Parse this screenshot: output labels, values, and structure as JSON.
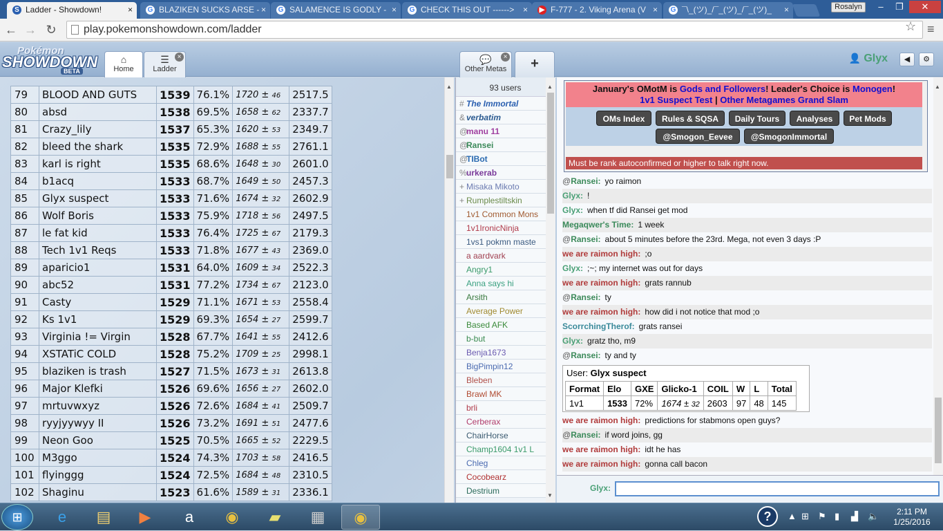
{
  "browser": {
    "tabs": [
      {
        "title": "Ladder - Showdown!",
        "icon": "S",
        "active": true
      },
      {
        "title": "BLAZIKEN SUCKS ARSE - ",
        "icon": "G"
      },
      {
        "title": "SALAMENCE IS GODLY - ",
        "icon": "G"
      },
      {
        "title": "CHECK THIS OUT ------>",
        "icon": "G"
      },
      {
        "title": "F-777 - 2. Viking Arena (V",
        "icon": "▶"
      },
      {
        "title": "¯\\_(ツ)_/¯_(ツ)_/¯_(ツ)_",
        "icon": "G"
      }
    ],
    "profile": "Rosalyn",
    "url": "play.pokemonshowdown.com/ladder"
  },
  "header": {
    "logo_top": "Pokémon",
    "logo_main": "SHOWDOWN",
    "logo_beta": "BETA",
    "tab_home": "Home",
    "tab_ladder": "Ladder",
    "tab_othermetas": "Other Metas",
    "tab_add": "+",
    "username": "Glyx"
  },
  "ladder": {
    "rows": [
      [
        "79",
        "BLOOD AND GUTS",
        "1539",
        "76.1%",
        "1720",
        "46",
        "2517.5"
      ],
      [
        "80",
        "absd",
        "1538",
        "69.5%",
        "1658",
        "62",
        "2337.7"
      ],
      [
        "81",
        "Crazy_lily",
        "1537",
        "65.3%",
        "1620",
        "53",
        "2349.7"
      ],
      [
        "82",
        "bleed the shark",
        "1535",
        "72.9%",
        "1688",
        "55",
        "2761.1"
      ],
      [
        "83",
        "karl is right",
        "1535",
        "68.6%",
        "1648",
        "30",
        "2601.0"
      ],
      [
        "84",
        "b1acq",
        "1533",
        "68.7%",
        "1649",
        "50",
        "2457.3"
      ],
      [
        "85",
        "Glyx suspect",
        "1533",
        "71.6%",
        "1674",
        "32",
        "2602.9"
      ],
      [
        "86",
        "Wolf Boris",
        "1533",
        "75.9%",
        "1718",
        "56",
        "2497.5"
      ],
      [
        "87",
        "le fat kid",
        "1533",
        "76.4%",
        "1725",
        "67",
        "2179.3"
      ],
      [
        "88",
        "Tech 1v1 Reqs",
        "1533",
        "71.8%",
        "1677",
        "43",
        "2369.0"
      ],
      [
        "89",
        "aparicio1",
        "1531",
        "64.0%",
        "1609",
        "34",
        "2522.3"
      ],
      [
        "90",
        "abc52",
        "1531",
        "77.2%",
        "1734",
        "67",
        "2123.0"
      ],
      [
        "91",
        "Casty",
        "1529",
        "71.1%",
        "1671",
        "53",
        "2558.4"
      ],
      [
        "92",
        "Ks 1v1",
        "1529",
        "69.3%",
        "1654",
        "27",
        "2599.7"
      ],
      [
        "93",
        "Virginia != Virgin",
        "1528",
        "67.7%",
        "1641",
        "55",
        "2412.6"
      ],
      [
        "94",
        "XSTATiC COLD",
        "1528",
        "75.2%",
        "1709",
        "25",
        "2998.1"
      ],
      [
        "95",
        "blaziken is trash",
        "1527",
        "71.5%",
        "1673",
        "31",
        "2613.8"
      ],
      [
        "96",
        "Major Klefki",
        "1526",
        "69.6%",
        "1656",
        "27",
        "2602.0"
      ],
      [
        "97",
        "mrtuvwxyz",
        "1526",
        "72.6%",
        "1684",
        "41",
        "2509.7"
      ],
      [
        "98",
        "ryyjyywyy II",
        "1526",
        "73.2%",
        "1691",
        "51",
        "2477.6"
      ],
      [
        "99",
        "Neon Goo",
        "1525",
        "70.5%",
        "1665",
        "52",
        "2229.5"
      ],
      [
        "100",
        "M3ggo",
        "1524",
        "74.3%",
        "1703",
        "58",
        "2416.5"
      ],
      [
        "101",
        "flyinggg",
        "1524",
        "72.5%",
        "1684",
        "48",
        "2310.5"
      ],
      [
        "102",
        "Shaginu",
        "1523",
        "61.6%",
        "1589",
        "31",
        "2336.1"
      ]
    ]
  },
  "userlist": {
    "count": "93 users",
    "users": [
      {
        "rank": "#",
        "name": "The Immortal",
        "color": "#2a5fb0",
        "style": "bi"
      },
      {
        "rank": "&",
        "name": "verbatim",
        "color": "#2a5a90",
        "style": "bi"
      },
      {
        "rank": "@",
        "name": "manu 11",
        "color": "#a040a0",
        "style": "b"
      },
      {
        "rank": "@",
        "name": "Ransei",
        "color": "#3c8a5a",
        "style": "b"
      },
      {
        "rank": "@",
        "name": "TIBot",
        "color": "#2a6ab0",
        "style": "b"
      },
      {
        "rank": "%",
        "name": "urkerab",
        "color": "#7a3a9a",
        "style": "b"
      },
      {
        "rank": "+",
        "name": "Misaka Mikoto",
        "color": "#6a7ab0",
        "style": ""
      },
      {
        "rank": "+",
        "name": "Rumplestiltskin",
        "color": "#6a8a4a",
        "style": ""
      },
      {
        "rank": "",
        "name": "1v1 Common Mons",
        "color": "#a05a30",
        "style": ""
      },
      {
        "rank": "",
        "name": "1v1IronicNinja",
        "color": "#b03a4a",
        "style": ""
      },
      {
        "rank": "",
        "name": "1vs1 pokmn maste",
        "color": "#3a5a80",
        "style": ""
      },
      {
        "rank": "",
        "name": "a aardvark",
        "color": "#a04050",
        "style": ""
      },
      {
        "rank": "",
        "name": "Angry1",
        "color": "#3a9a6a",
        "style": ""
      },
      {
        "rank": "",
        "name": "Anna says hi",
        "color": "#3aa080",
        "style": ""
      },
      {
        "rank": "",
        "name": "Arsith",
        "color": "#3a7a40",
        "style": ""
      },
      {
        "rank": "",
        "name": "Average Power",
        "color": "#a08a30",
        "style": ""
      },
      {
        "rank": "",
        "name": "Based AFK",
        "color": "#3a8a3a",
        "style": ""
      },
      {
        "rank": "",
        "name": "b-but",
        "color": "#3a8a50",
        "style": ""
      },
      {
        "rank": "",
        "name": "Benja1673",
        "color": "#6a5ab0",
        "style": ""
      },
      {
        "rank": "",
        "name": "BigPimpin12",
        "color": "#4a6ab0",
        "style": ""
      },
      {
        "rank": "",
        "name": "Bleben",
        "color": "#b0504a",
        "style": ""
      },
      {
        "rank": "",
        "name": "Brawl MK",
        "color": "#b04a30",
        "style": ""
      },
      {
        "rank": "",
        "name": "brli",
        "color": "#b03a4a",
        "style": ""
      },
      {
        "rank": "",
        "name": "Cerberax",
        "color": "#b03a6a",
        "style": ""
      },
      {
        "rank": "",
        "name": "ChairHorse",
        "color": "#3a5a70",
        "style": ""
      },
      {
        "rank": "",
        "name": "Champ1604 1v1 L",
        "color": "#3a9a6a",
        "style": ""
      },
      {
        "rank": "",
        "name": "Chleg",
        "color": "#4a6ab0",
        "style": ""
      },
      {
        "rank": "",
        "name": "Cocobearz",
        "color": "#b03030",
        "style": ""
      },
      {
        "rank": "",
        "name": "Destrium",
        "color": "#2a6a5a",
        "style": ""
      }
    ]
  },
  "chat": {
    "banner_pre": "January's OMotM is ",
    "banner_link1": "Gods and Followers",
    "banner_mid": "! Leader's Choice is ",
    "banner_link2": "Monogen",
    "banner_end": "!",
    "banner_line2a": "1v1 Suspect Test",
    "banner_sep": " | ",
    "banner_line2b": "Other Metagames Grand Slam",
    "buttons": [
      "OMs Index",
      "Rules & SQSA",
      "Daily Tours",
      "Analyses",
      "Pet Mods",
      "@Smogon_Eevee",
      "@SmogonImmortal"
    ],
    "notice": "Must be rank autoconfirmed or higher to talk right now.",
    "messages": [
      {
        "rank": "@",
        "user": "Ransei:",
        "text": "yo raimon",
        "color": "#3c8a5a"
      },
      {
        "rank": "",
        "user": "Glyx:",
        "text": "!",
        "color": "#4aa076"
      },
      {
        "rank": "",
        "user": "Glyx:",
        "text": "when tf did Ransei get mod",
        "color": "#4aa076"
      },
      {
        "rank": "",
        "user": "Megaqwer's Time:",
        "text": "1 week",
        "color": "#3a8a5a"
      },
      {
        "rank": "@",
        "user": "Ransei:",
        "text": "about 5 minutes before the 23rd. Mega, not even 3 days :P",
        "color": "#3c8a5a"
      },
      {
        "rank": "",
        "user": "we are raimon high:",
        "text": ";o",
        "color": "#b03a3a"
      },
      {
        "rank": "",
        "user": "Glyx:",
        "text": ";~; my internet was out for days",
        "color": "#4aa076"
      },
      {
        "rank": "",
        "user": "we are raimon high:",
        "text": "grats rannub",
        "color": "#b03a3a"
      },
      {
        "rank": "@",
        "user": "Ransei:",
        "text": "ty",
        "color": "#3c8a5a"
      },
      {
        "rank": "",
        "user": "we are raimon high:",
        "text": "how did i not notice that mod ;o",
        "color": "#b03a3a"
      },
      {
        "rank": "",
        "user": "ScorrchingTherof:",
        "text": "grats ransei",
        "color": "#3a8a9a"
      },
      {
        "rank": "",
        "user": "Glyx:",
        "text": "gratz tho, m9",
        "color": "#4aa076"
      },
      {
        "rank": "@",
        "user": "Ransei:",
        "text": "ty and ty",
        "color": "#3c8a5a"
      }
    ],
    "rankcard": {
      "label": "User: ",
      "user": "Glyx suspect",
      "headers": [
        "Format",
        "Elo",
        "GXE",
        "Glicko-1",
        "COIL",
        "W",
        "L",
        "Total"
      ],
      "values": [
        "1v1",
        "1533",
        "72%",
        "1674",
        "32",
        "2603",
        "97",
        "48",
        "145"
      ]
    },
    "messages2": [
      {
        "rank": "",
        "user": "we are raimon high:",
        "text": "predictions for stabmons open guys?",
        "color": "#b03a3a"
      },
      {
        "rank": "@",
        "user": "Ransei:",
        "text": "if word joins, gg",
        "color": "#3c8a5a"
      },
      {
        "rank": "",
        "user": "we are raimon high:",
        "text": "idt he has",
        "color": "#b03a3a"
      },
      {
        "rank": "",
        "user": "we are raimon high:",
        "text": "gonna call bacon",
        "color": "#b03a3a"
      }
    ],
    "input_label": "Glyx:"
  },
  "taskbar": {
    "time": "2:11 PM",
    "date": "1/25/2016"
  }
}
